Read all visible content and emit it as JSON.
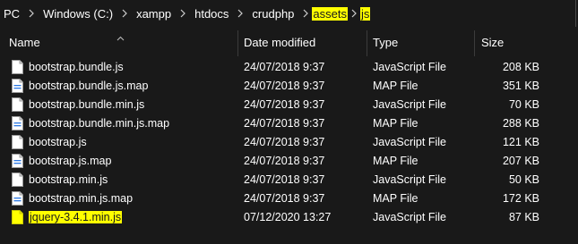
{
  "breadcrumb": {
    "items": [
      {
        "label": "PC",
        "highlight": false
      },
      {
        "label": "Windows (C:)",
        "highlight": false
      },
      {
        "label": "xampp",
        "highlight": false
      },
      {
        "label": "htdocs",
        "highlight": false
      },
      {
        "label": "crudphp",
        "highlight": false
      },
      {
        "label": "assets",
        "highlight": true
      },
      {
        "label": "js",
        "highlight": true
      }
    ]
  },
  "columns": {
    "name": "Name",
    "date": "Date modified",
    "type": "Type",
    "size": "Size",
    "sort_icon": "chevron-up-icon"
  },
  "files": [
    {
      "name": "bootstrap.bundle.js",
      "date": "24/07/2018 9:37",
      "type": "JavaScript File",
      "size": "208 KB",
      "icon": "js-file-icon"
    },
    {
      "name": "bootstrap.bundle.js.map",
      "date": "24/07/2018 9:37",
      "type": "MAP File",
      "size": "351 KB",
      "icon": "map-file-icon"
    },
    {
      "name": "bootstrap.bundle.min.js",
      "date": "24/07/2018 9:37",
      "type": "JavaScript File",
      "size": "70 KB",
      "icon": "js-file-icon"
    },
    {
      "name": "bootstrap.bundle.min.js.map",
      "date": "24/07/2018 9:37",
      "type": "MAP File",
      "size": "288 KB",
      "icon": "map-file-icon"
    },
    {
      "name": "bootstrap.js",
      "date": "24/07/2018 9:37",
      "type": "JavaScript File",
      "size": "121 KB",
      "icon": "js-file-icon"
    },
    {
      "name": "bootstrap.js.map",
      "date": "24/07/2018 9:37",
      "type": "MAP File",
      "size": "207 KB",
      "icon": "map-file-icon"
    },
    {
      "name": "bootstrap.min.js",
      "date": "24/07/2018 9:37",
      "type": "JavaScript File",
      "size": "50 KB",
      "icon": "js-file-icon"
    },
    {
      "name": "bootstrap.min.js.map",
      "date": "24/07/2018 9:37",
      "type": "MAP File",
      "size": "172 KB",
      "icon": "map-file-icon"
    },
    {
      "name": "jquery-3.4.1.min.js",
      "date": "07/12/2020 13:27",
      "type": "JavaScript File",
      "size": "87 KB",
      "icon": "js-file-icon",
      "highlight": true
    }
  ],
  "colors": {
    "background": "#191919",
    "text": "#ffffff",
    "highlight": "#ffff00",
    "highlight_text": "#1a1a1a"
  }
}
